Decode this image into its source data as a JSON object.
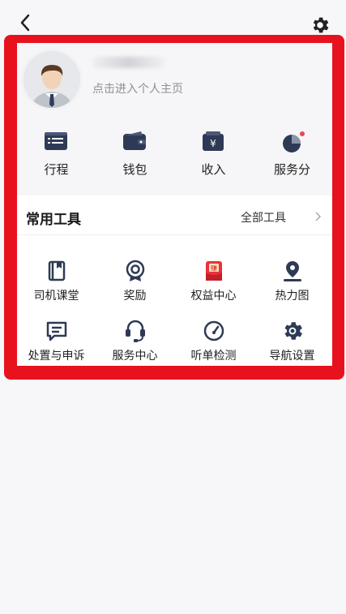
{
  "header": {
    "back_icon": "chevron-left-icon",
    "settings_icon": "gear-icon"
  },
  "profile": {
    "subtitle": "点击进入个人主页"
  },
  "quick_actions": [
    {
      "label": "行程",
      "icon": "list-icon"
    },
    {
      "label": "钱包",
      "icon": "wallet-icon"
    },
    {
      "label": "收入",
      "icon": "income-icon"
    },
    {
      "label": "服务分",
      "icon": "pie-chart-icon",
      "badge_color": "#f0464e"
    }
  ],
  "tools": {
    "title": "常用工具",
    "all_label": "全部工具",
    "items": [
      {
        "label": "司机课堂",
        "icon": "book-icon"
      },
      {
        "label": "奖励",
        "icon": "reward-icon"
      },
      {
        "label": "权益中心",
        "icon": "red-envelope-icon",
        "icon_text": "赚"
      },
      {
        "label": "热力图",
        "icon": "location-pin-icon"
      },
      {
        "label": "处置与申诉",
        "icon": "message-icon"
      },
      {
        "label": "服务中心",
        "icon": "headset-icon"
      },
      {
        "label": "听单检测",
        "icon": "gauge-icon"
      },
      {
        "label": "导航设置",
        "icon": "settings-icon"
      }
    ]
  },
  "colors": {
    "icon_dark": "#2e3a55",
    "accent_red": "#e8121e",
    "badge": "#f0464e"
  }
}
